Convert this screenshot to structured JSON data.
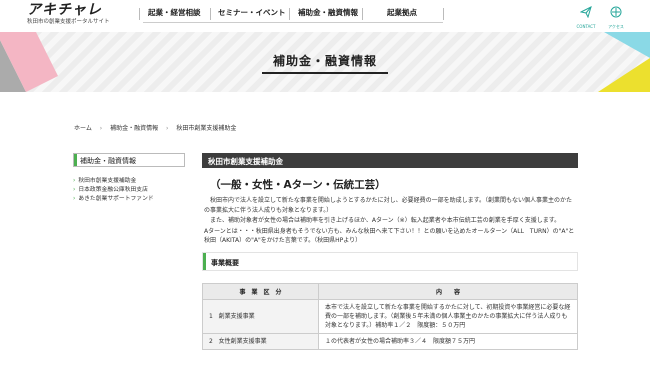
{
  "header": {
    "logo": "アキチャレ",
    "logo_sub": "秋田市の創業支援ポータルサイト",
    "nav": [
      "起業・経営相談",
      "セミナー・イベント",
      "補助金・融資情報",
      "起業拠点"
    ],
    "contact_label": "CONTACT",
    "access_label": "アクセス"
  },
  "banner": {
    "title": "補助金・融資情報"
  },
  "breadcrumb": [
    "ホーム",
    "補助金・融資情報",
    "秋田市創業支援補助金"
  ],
  "sidebar": {
    "heading": "補助金・融資情報",
    "items": [
      "秋田市創業支援補助金",
      "日本政策金融公庫秋田支店",
      "あきた創業サポートファンド"
    ]
  },
  "main": {
    "heading": "秋田市創業支援補助金",
    "subtitle": "（一般・女性・Aターン・伝統工芸）",
    "paragraphs": [
      "　秋田市内で法人を設立して新たな事業を開始しようとするかたに対し、必要経費の一部を助成します。（創業間もない個人事業主のかたの事業拡大に伴う法人成りも対象となります。）",
      "　また、補助対象者が女性の場合は補助率を引き上げるほか、Aターン（※）転入起業者や本市伝統工芸の創業を手厚く支援します。",
      "Aターンとは・・・秋田県出身者もそうでない方も、みんな秋田へ来て下さい！！との願いを込めたオールターン（ALL　TURN）の\"A\"と秋田（AKITA）の\"A\"をかけた言葉です。（秋田県HPより）"
    ],
    "section_title": "事業概要",
    "table": {
      "headers": [
        "事　業　区　分",
        "内　　容"
      ],
      "rows": [
        {
          "no": "1",
          "name": "創業支援事業",
          "content": "本市で法人を設立して新たな事業を開始するかたに対して、初期投資や事業経営に必要な経費の一部を補助します。（創業後５年未満の個人事業主のかたの事業拡大に伴う法人成りも対象となります。）補助率１／２　限度額：５０万円"
        },
        {
          "no": "2",
          "name": "女性創業支援事業",
          "content": "１の代表者が女性の場合補助率３／４　限度額７５万円"
        }
      ]
    }
  }
}
